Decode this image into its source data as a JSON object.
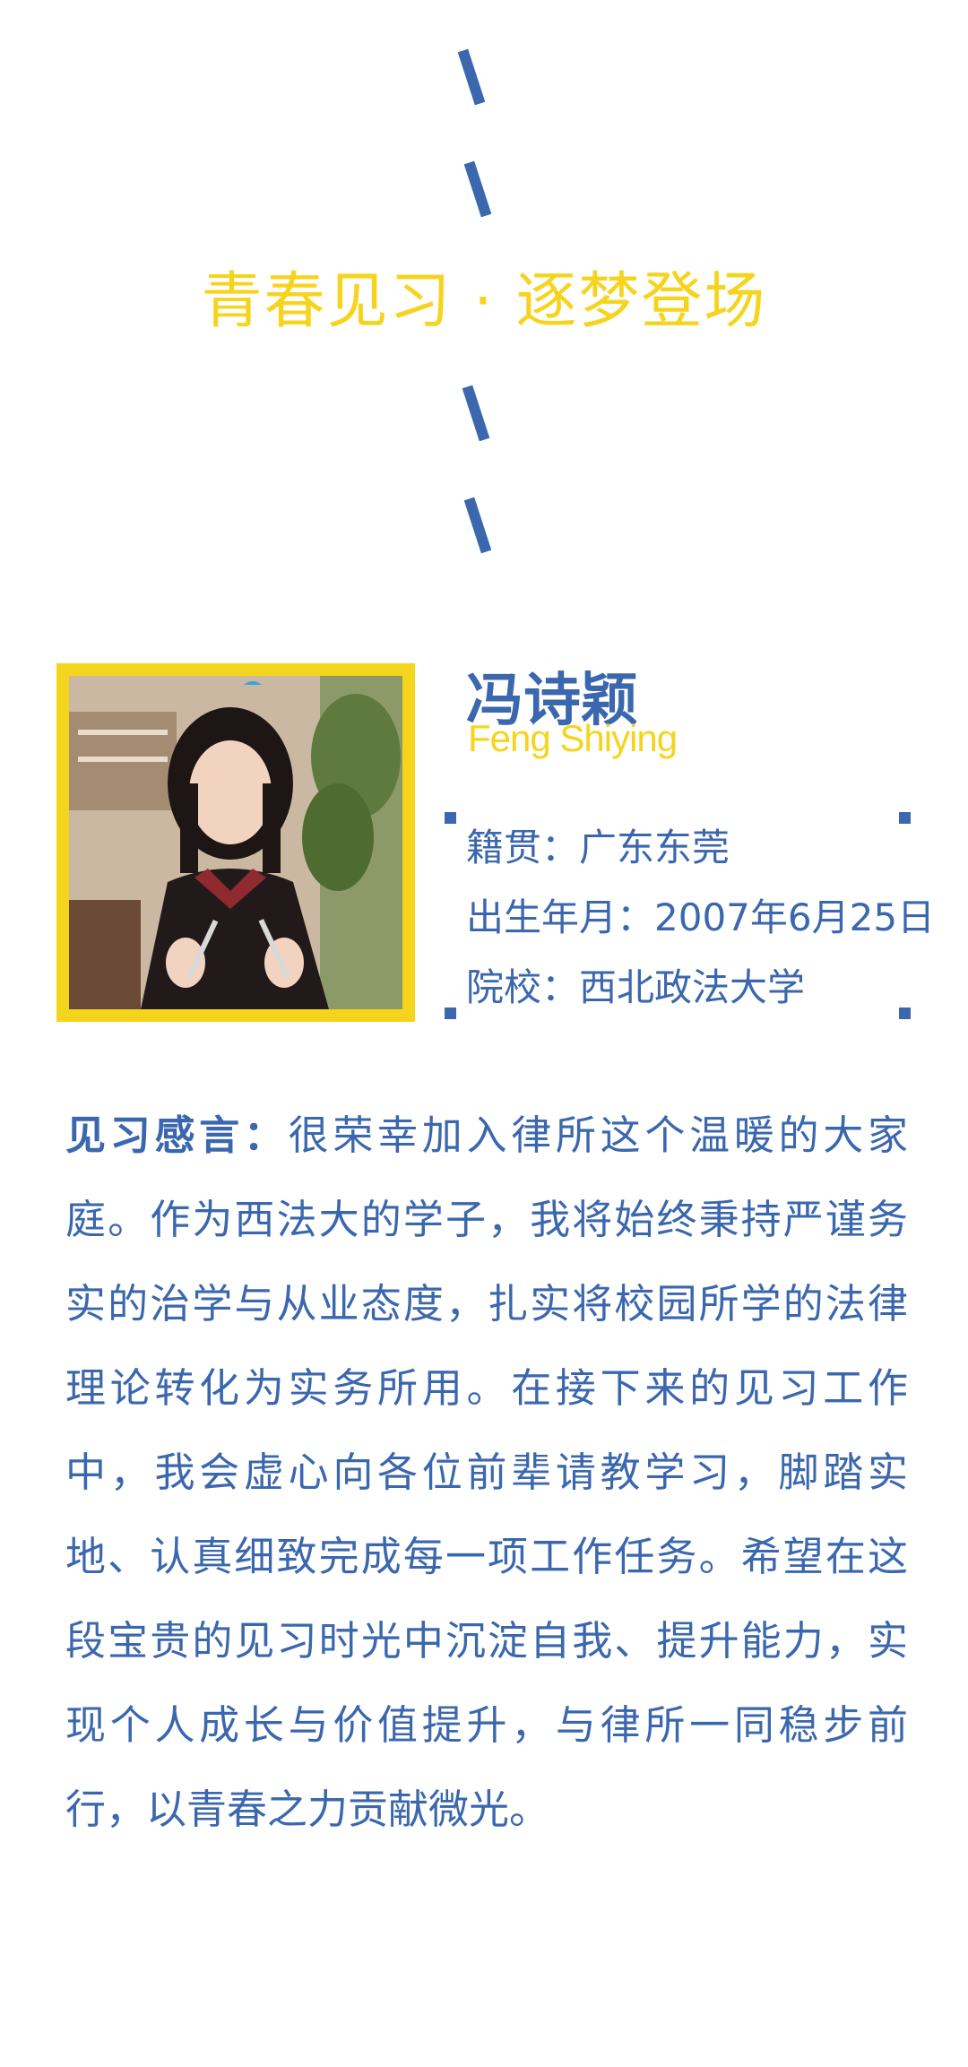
{
  "headline": "青春见习 · 逐梦登场",
  "profile": {
    "name_cn": "冯诗颖",
    "name_en": "Feng Shiying",
    "photo_alt": "冯诗颖照片"
  },
  "info": {
    "hometown": "籍贯：广东东莞",
    "birth": "出生年月：2007年6月25日",
    "school": "院校：西北政法大学"
  },
  "speech": {
    "label": "见习感言：",
    "text": "很荣幸加入律所这个温暖的大家庭。作为西法大的学子，我将始终秉持严谨务实的治学与从业态度，扎实将校园所学的法律理论转化为实务所用。在接下来的见习工作中，我会虚心向各位前辈请教学习，脚踏实地、认真细致完成每一项工作任务。希望在这段宝贵的见习时光中沉淀自我、提升能力，实现个人成长与价值提升，与律所一同稳步前行，以青春之力贡献微光。"
  },
  "colors": {
    "blue": "#3a67ad",
    "yellow": "#f6d41d",
    "background": "#ffffff"
  }
}
